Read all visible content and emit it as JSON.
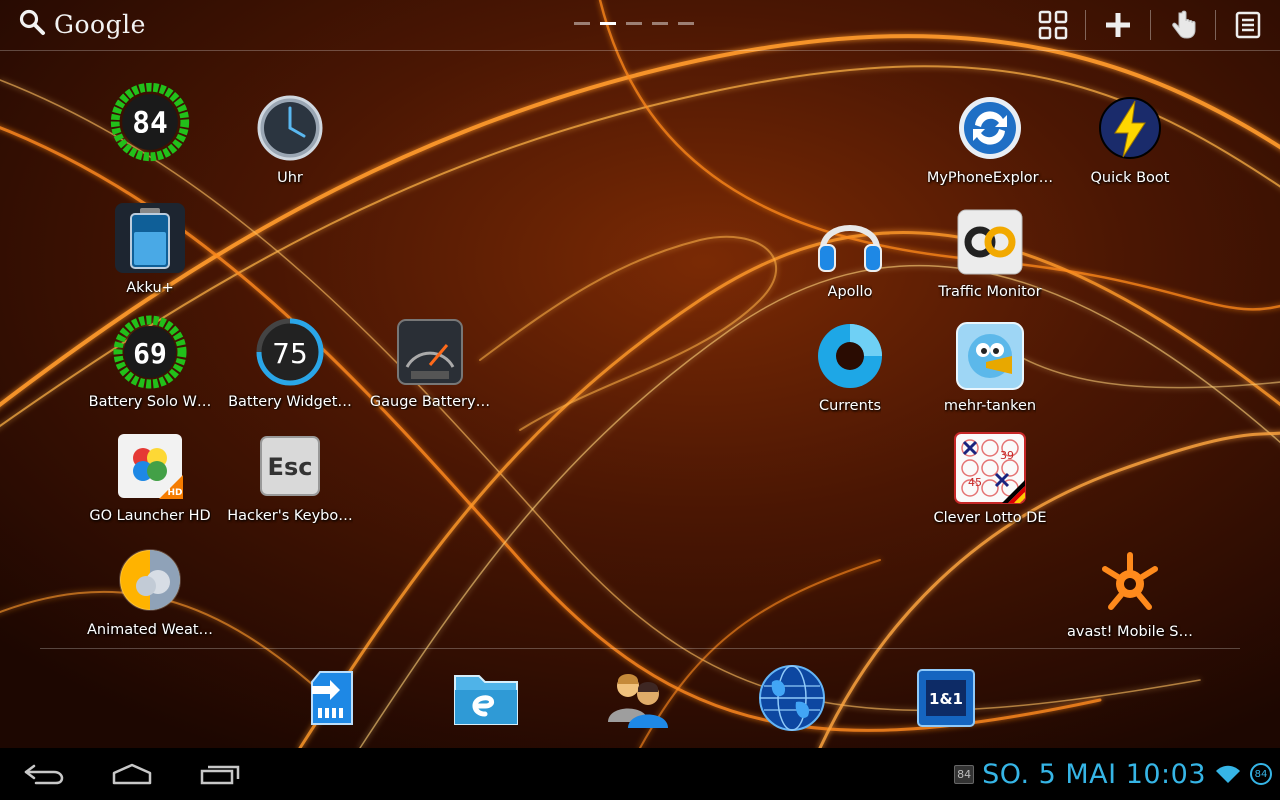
{
  "search": {
    "label": "Google",
    "icon": "search-icon"
  },
  "page_indicator": {
    "count": 5,
    "active_index": 1
  },
  "top_actions": [
    {
      "name": "apps-grid-icon"
    },
    {
      "name": "add-icon"
    },
    {
      "name": "touch-gesture-icon"
    },
    {
      "name": "menu-icon"
    }
  ],
  "apps": {
    "battery84": {
      "label": "",
      "value": "84"
    },
    "uhr": {
      "label": "Uhr"
    },
    "akku": {
      "label": "Akku+"
    },
    "battery_solo": {
      "label": "Battery Solo W…",
      "value": "69"
    },
    "battery_widget": {
      "label": "Battery Widget…",
      "value": "75"
    },
    "gauge_battery": {
      "label": "Gauge Battery…"
    },
    "go_launcher": {
      "label": "GO Launcher HD",
      "badge": "HD"
    },
    "hackers_keyboard": {
      "label": "Hacker's Keybo…",
      "key": "Esc"
    },
    "animated_weather": {
      "label": "Animated Weat…"
    },
    "myphoneexplorer": {
      "label": "MyPhoneExplor…"
    },
    "quick_boot": {
      "label": "Quick Boot"
    },
    "apollo": {
      "label": "Apollo"
    },
    "traffic_monitor": {
      "label": "Traffic Monitor"
    },
    "currents": {
      "label": "Currents"
    },
    "mehr_tanken": {
      "label": "mehr-tanken"
    },
    "clever_lotto": {
      "label": "Clever Lotto DE",
      "numbers": [
        "39",
        "45"
      ]
    },
    "avast": {
      "label": "avast! Mobile S…"
    }
  },
  "dock": [
    {
      "name": "sd-card-transfer-icon"
    },
    {
      "name": "file-explorer-icon"
    },
    {
      "name": "contacts-icon"
    },
    {
      "name": "browser-globe-icon"
    },
    {
      "name": "one-and-one-icon",
      "text": "1&1"
    }
  ],
  "system_bar": {
    "clock": "SO. 5 MAI 10:03",
    "battery_mini": "84",
    "battery_level": "84"
  },
  "colors": {
    "accent": "#36b5e6",
    "wallpaper_base": "#2a0c02",
    "wallpaper_swirl": "#ff8a1c",
    "battery_green": "#22c01a"
  }
}
